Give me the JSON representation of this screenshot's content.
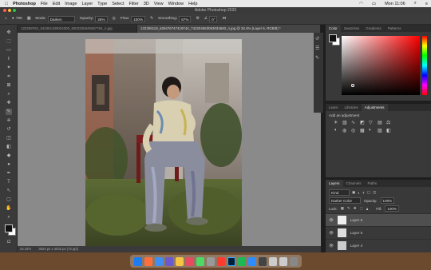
{
  "menubar": {
    "items": [
      "Photoshop",
      "File",
      "Edit",
      "Image",
      "Layer",
      "Type",
      "Select",
      "Filter",
      "3D",
      "View",
      "Window",
      "Help"
    ],
    "time": "Mon 11:06"
  },
  "window": {
    "title": "Adobe Photoshop 2020"
  },
  "options": {
    "mode_label": "Mode:",
    "mode_value": "Darken",
    "opacity_label": "Opacity:",
    "opacity_value": "26%",
    "flow_label": "Flow:",
    "flow_value": "100%",
    "smoothing_label": "Smoothing:",
    "smoothing_value": "67%",
    "angle_value": "0°",
    "brush_size": "765"
  },
  "doc_tabs": [
    {
      "label": "123208763_341061330024300_6003325349367764_n.jpg"
    },
    {
      "label": "122306119_629476747419744_742204663063034683_n.jpg @ 34.4% (Layer 6, RGB/8) *"
    }
  ],
  "status": {
    "zoom": "34.42%",
    "doc": "3024 px x 4032 px (72 ppi)"
  },
  "color_panel": {
    "tabs": [
      "Color",
      "Swatches",
      "Gradients",
      "Patterns"
    ],
    "hue_color": "#ff0000"
  },
  "adjust_panel": {
    "tabs": [
      "Learn",
      "Libraries",
      "Adjustments"
    ],
    "add_label": "Add an adjustment"
  },
  "layers_panel": {
    "tabs": [
      "Layers",
      "Channels",
      "Paths"
    ],
    "kind": "Kind",
    "blend": "Darker Color",
    "opacity_label": "Opacity:",
    "opacity_value": "100%",
    "lock_label": "Lock:",
    "fill_label": "Fill:",
    "fill_value": "100%",
    "layers": [
      "Layer 6",
      "Layer 5",
      "Layer 4"
    ]
  },
  "colors": {
    "fg": "#111111",
    "bg": "#ffffff"
  }
}
